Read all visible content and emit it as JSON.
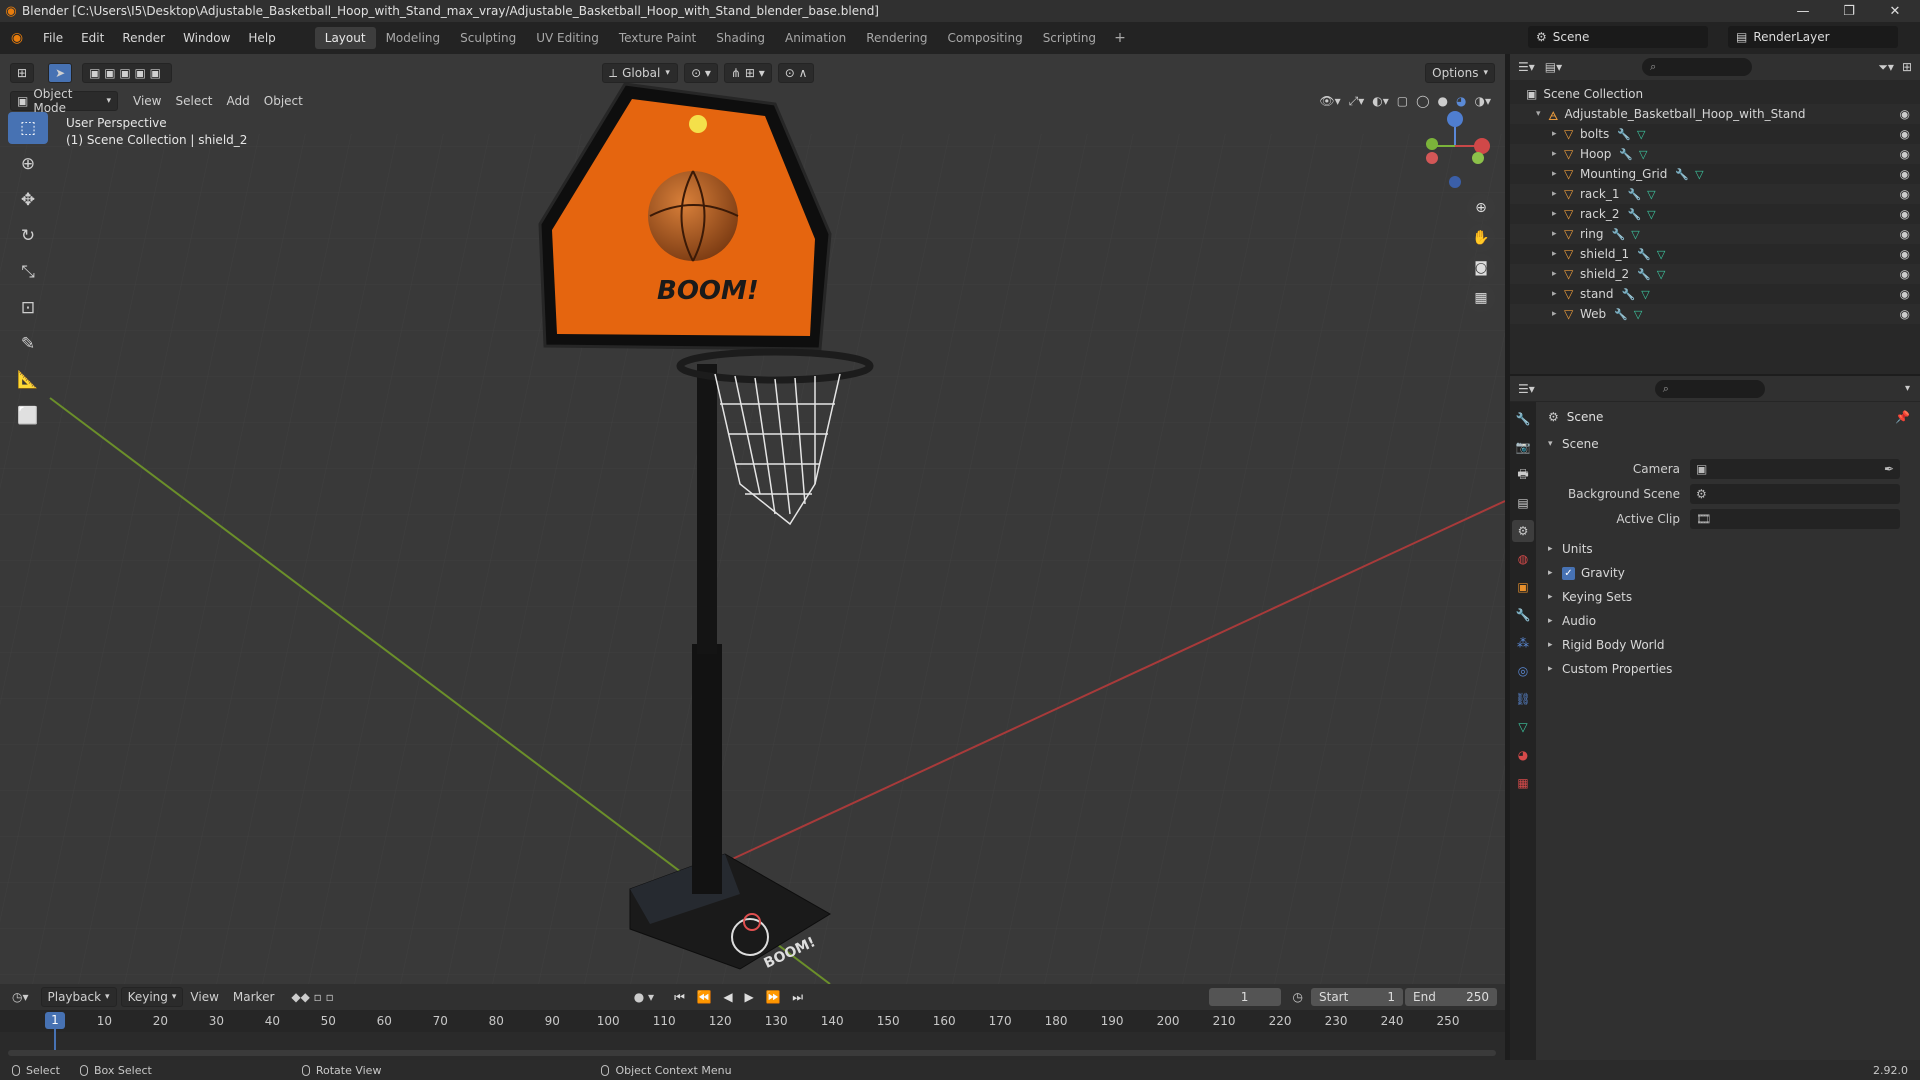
{
  "window": {
    "title": "Blender [C:\\Users\\I5\\Desktop\\Adjustable_Basketball_Hoop_with_Stand_max_vray/Adjustable_Basketball_Hoop_with_Stand_blender_base.blend]",
    "minimize": "—",
    "restore": "❐",
    "close": "✕"
  },
  "menubar": {
    "items": [
      "File",
      "Edit",
      "Render",
      "Window",
      "Help"
    ],
    "workspaces": [
      "Layout",
      "Modeling",
      "Sculpting",
      "UV Editing",
      "Texture Paint",
      "Shading",
      "Animation",
      "Rendering",
      "Compositing",
      "Scripting"
    ],
    "active_workspace": "Layout",
    "add_workspace": "+",
    "scene_name": "Scene",
    "view_layer": "RenderLayer"
  },
  "viewport": {
    "mode": "Object Mode",
    "menus": [
      "View",
      "Select",
      "Add",
      "Object"
    ],
    "transform_orientation": "Global",
    "options_label": "Options",
    "overlay_line1": "User Perspective",
    "overlay_line2": "(1) Scene Collection | shield_2",
    "backboard_text": "BOOM!",
    "base_text": "BOOM!"
  },
  "toolbar": {
    "tools": [
      "select-box-tool",
      "cursor-tool",
      "move-tool",
      "rotate-tool",
      "scale-tool",
      "transform-tool",
      "annotate-tool",
      "measure-tool",
      "add-cube-tool"
    ]
  },
  "outliner": {
    "search_placeholder": "",
    "root": "Scene Collection",
    "collection": "Adjustable_Basketball_Hoop_with_Stand",
    "objects": [
      "bolts",
      "Hoop",
      "Mounting_Grid",
      "rack_1",
      "rack_2",
      "ring",
      "shield_1",
      "shield_2",
      "stand",
      "Web"
    ]
  },
  "properties": {
    "context": "Scene",
    "panel": "Scene",
    "fields": [
      {
        "label": "Camera",
        "value": ""
      },
      {
        "label": "Background Scene",
        "value": ""
      },
      {
        "label": "Active Clip",
        "value": ""
      }
    ],
    "sub_panels": [
      "Units",
      "Gravity",
      "Keying Sets",
      "Audio",
      "Rigid Body World",
      "Custom Properties"
    ],
    "gravity_checked": true
  },
  "timeline": {
    "menus": [
      "Playback",
      "Keying",
      "View",
      "Marker"
    ],
    "current_frame": "1",
    "start_label": "Start",
    "start": "1",
    "end_label": "End",
    "end": "250",
    "ticks": [
      "1",
      "10",
      "20",
      "30",
      "40",
      "50",
      "60",
      "70",
      "80",
      "90",
      "100",
      "110",
      "120",
      "130",
      "140",
      "150",
      "160",
      "170",
      "180",
      "190",
      "200",
      "210",
      "220",
      "230",
      "240",
      "250"
    ]
  },
  "statusbar": {
    "select": "Select",
    "box_select": "Box Select",
    "rotate_view": "Rotate View",
    "context_menu": "Object Context Menu",
    "version": "2.92.0"
  },
  "colors": {
    "accent": "#4772b3",
    "blender_orange": "#e87d0d",
    "backboard": "#e5650f",
    "x_axis": "#d04848",
    "y_axis": "#7bb33a"
  }
}
